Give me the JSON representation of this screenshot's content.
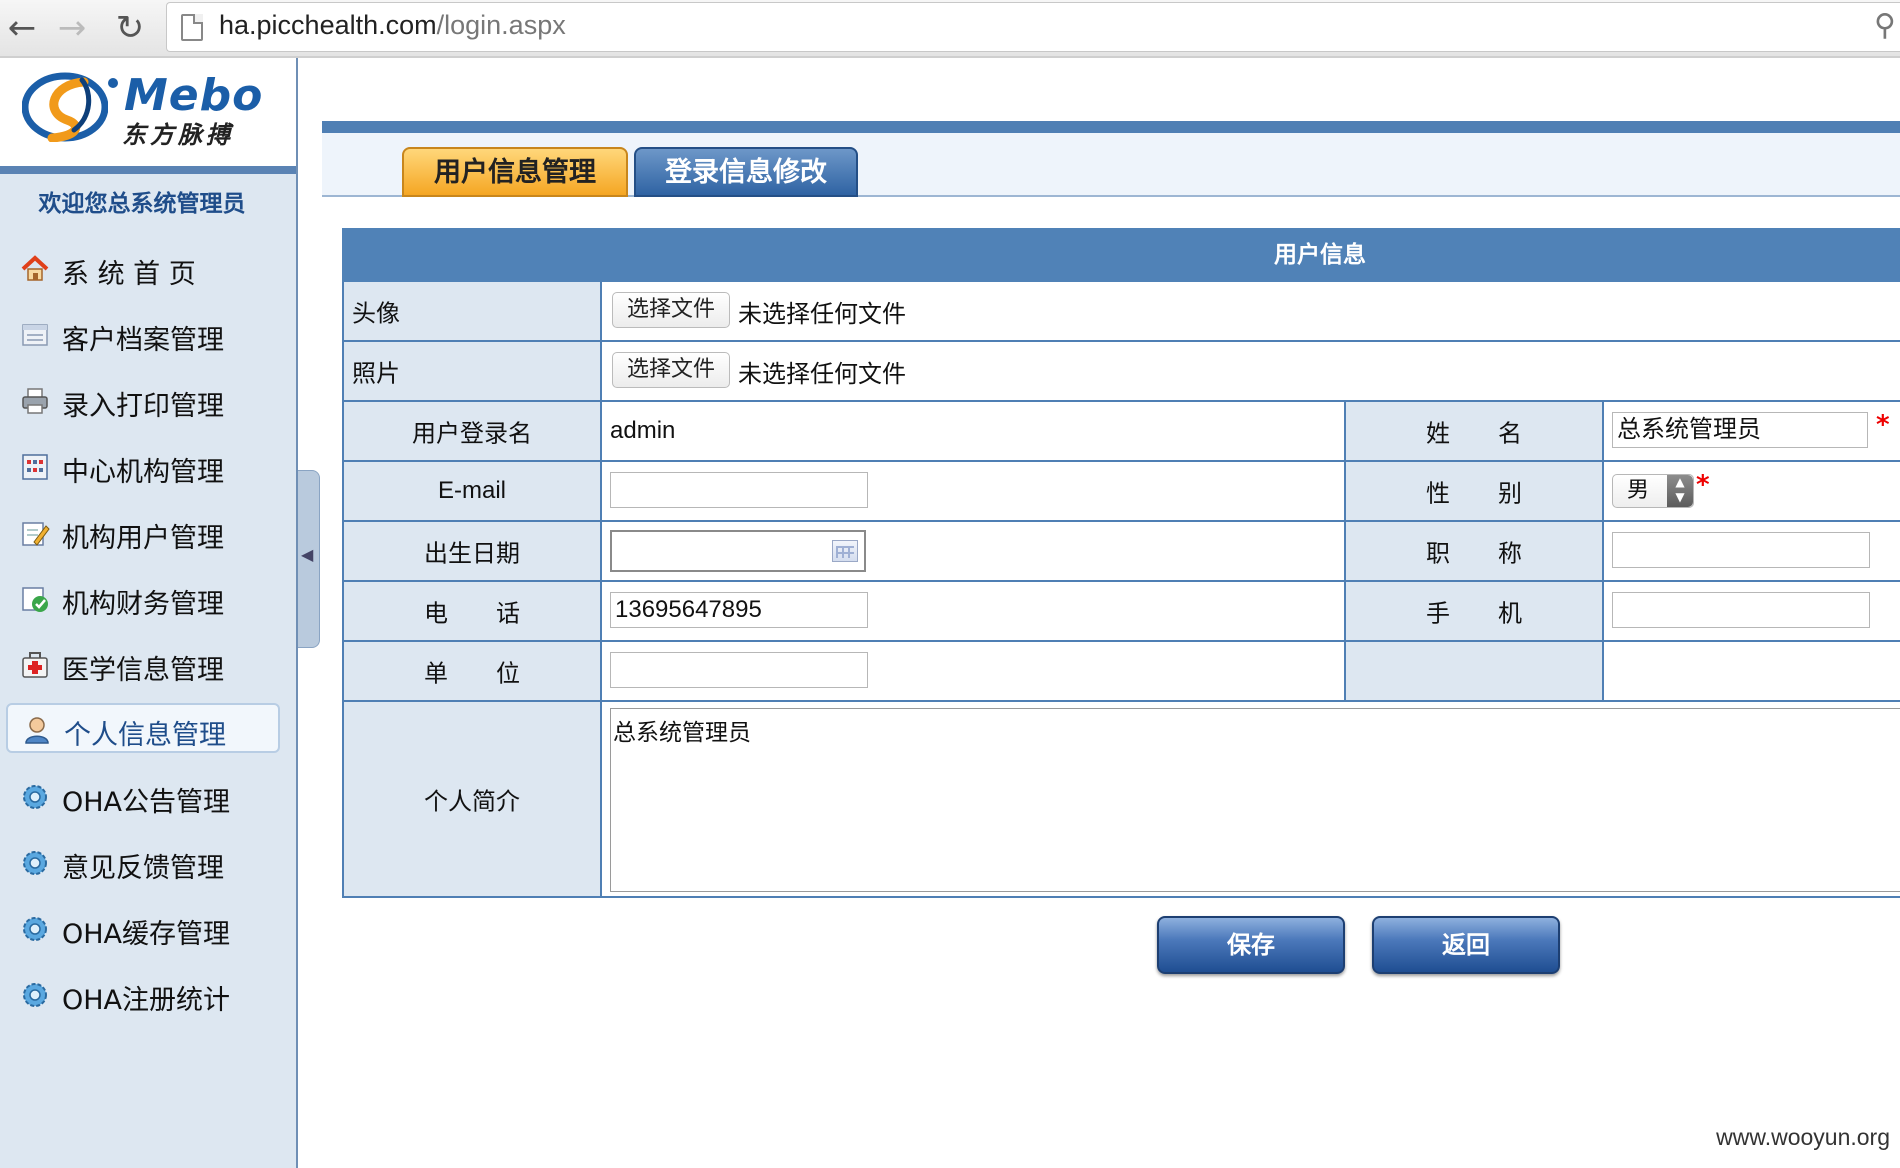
{
  "browser": {
    "url_host": "ha.picchealth.com",
    "url_path": "/login.aspx"
  },
  "sidebar": {
    "logo_name": "Mebo",
    "logo_cn": "东方脉搏",
    "welcome": "欢迎您总系统管理员",
    "items": [
      {
        "label": "系 统 首 页",
        "icon": "home-icon"
      },
      {
        "label": "客户档案管理",
        "icon": "archive-icon"
      },
      {
        "label": "录入打印管理",
        "icon": "printer-icon"
      },
      {
        "label": "中心机构管理",
        "icon": "building-icon"
      },
      {
        "label": "机构用户管理",
        "icon": "edit-user-icon"
      },
      {
        "label": "机构财务管理",
        "icon": "finance-icon"
      },
      {
        "label": "医学信息管理",
        "icon": "medical-kit-icon"
      },
      {
        "label": "个人信息管理",
        "icon": "person-icon"
      },
      {
        "label": "OHA公告管理",
        "icon": "gear-icon"
      },
      {
        "label": "意见反馈管理",
        "icon": "gear-icon"
      },
      {
        "label": "OHA缓存管理",
        "icon": "gear-icon"
      },
      {
        "label": "OHA注册统计",
        "icon": "gear-icon"
      }
    ],
    "active_index": 7
  },
  "tabs": {
    "user_info": "用户信息管理",
    "login_info": "登录信息修改"
  },
  "form": {
    "title": "用户信息",
    "avatar_label": "头像",
    "photo_label": "照片",
    "file_button": "选择文件",
    "file_status": "未选择任何文件",
    "login_name_label": "用户登录名",
    "login_name_value": "admin",
    "name_label": "姓　　名",
    "name_value": "总系统管理员",
    "email_label": "E-mail",
    "email_value": "",
    "gender_label": "性　　别",
    "gender_value": "男",
    "birthday_label": "出生日期",
    "birthday_value": "",
    "title_label": "职　　称",
    "title_value": "",
    "phone_label": "电　　话",
    "phone_value": "13695647895",
    "mobile_label": "手　　机",
    "mobile_value": "",
    "unit_label": "单　　位",
    "unit_value": "",
    "bio_label": "个人简介",
    "bio_value": "总系统管理员",
    "required_mark": "*"
  },
  "actions": {
    "save": "保存",
    "back": "返回"
  },
  "watermark": "www.wooyun.org",
  "colors": {
    "accent": "#5082b7",
    "sidebar_bg": "#dde7f1",
    "tab_active": "#f5a623",
    "required": "#ee0000"
  }
}
